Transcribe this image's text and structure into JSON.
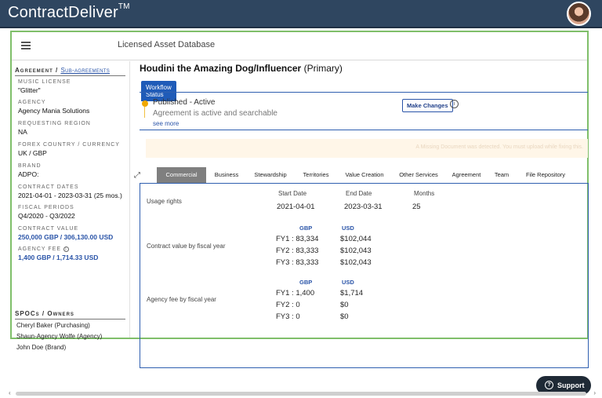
{
  "app": {
    "brand": "ContractDeliver",
    "brand_tm": "TM"
  },
  "header": {
    "menu_icon": "hamburger-icon",
    "title": "Licensed Asset Database"
  },
  "sidebar": {
    "heading": "Agreement",
    "heading_sep": " / ",
    "heading_link": "Sub-agreements",
    "fields": [
      {
        "label": "Music License",
        "value": "\"Glitter\""
      },
      {
        "label": "Agency",
        "value": "Agency Mania Solutions"
      },
      {
        "label": "Requesting Region",
        "value": "NA"
      },
      {
        "label": "Forex Country / Currency",
        "value": "UK / GBP"
      },
      {
        "label": "Brand",
        "value": "ADPO:"
      },
      {
        "label": "Contract Dates",
        "value": "2021-04-01 - 2023-03-31 (25 mos.)"
      },
      {
        "label": "Fiscal Periods",
        "value": "Q4/2020 - Q3/2022"
      },
      {
        "label": "Contract Value",
        "value": "250,000 GBP / 306,130.00 USD"
      },
      {
        "label": "Agency Fee",
        "value": "1,400 GBP / 1,714.33 USD"
      }
    ],
    "spoc_heading": "SPOCs / Owners",
    "spocs": [
      "Cheryl Baker (Purchasing)",
      "Shaun-Agency Wolfe (Agency)",
      "John Doe (Brand)"
    ]
  },
  "asset": {
    "title": "Houdini the Amazing Dog/Influencer",
    "qualifier": "(Primary)"
  },
  "workflow": {
    "tab_label": "Workflow Status",
    "status": "Published - Active",
    "description": "Agreement is active and searchable",
    "see_more": "see more",
    "make_changes": "Make Changes"
  },
  "notice_text": "A Missing Document was detected. You must upload while fixing this.",
  "tabs": [
    "Commercial",
    "Business",
    "Stewardship",
    "Territories",
    "Value Creation",
    "Other Services",
    "Agreement",
    "Team",
    "File Repository"
  ],
  "active_tab": "Commercial",
  "commercial": {
    "usage_label": "Usage rights",
    "col_start": "Start Date",
    "col_end": "End Date",
    "col_months": "Months",
    "start_date": "2021-04-01",
    "end_date": "2023-03-31",
    "months": "25",
    "contract_label": "Contract value by fiscal year",
    "cur_gbp": "GBP",
    "cur_usd": "USD",
    "contract_rows": [
      {
        "fy": "FY1 : 83,334",
        "usd": "$102,044"
      },
      {
        "fy": "FY2 : 83,333",
        "usd": "$102,043"
      },
      {
        "fy": "FY3 : 83,333",
        "usd": "$102,043"
      }
    ],
    "fee_label": "Agency fee by fiscal year",
    "fee_rows": [
      {
        "fy": "FY1 : 1,400",
        "usd": "$1,714"
      },
      {
        "fy": "FY2 : 0",
        "usd": "$0"
      },
      {
        "fy": "FY3 : 0",
        "usd": "$0"
      }
    ]
  },
  "support": {
    "label": "Support"
  },
  "colors": {
    "topbar": "#2f4660",
    "accent": "#1f5bb8",
    "frame": "#7fbf6a",
    "status": "#f0a800"
  }
}
